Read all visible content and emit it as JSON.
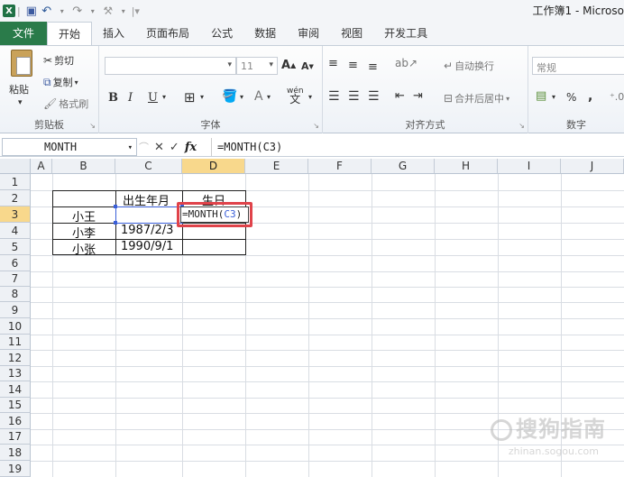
{
  "titlebar": {
    "app_title": "工作簿1 - Microso"
  },
  "tabs": [
    {
      "label": "文件"
    },
    {
      "label": "开始"
    },
    {
      "label": "插入"
    },
    {
      "label": "页面布局"
    },
    {
      "label": "公式"
    },
    {
      "label": "数据"
    },
    {
      "label": "审阅"
    },
    {
      "label": "视图"
    },
    {
      "label": "开发工具"
    }
  ],
  "ribbon": {
    "clipboard": {
      "paste": "粘贴",
      "cut": "剪切",
      "copy": "复制",
      "format_painter": "格式刷",
      "group": "剪贴板"
    },
    "font": {
      "font_name": "",
      "font_size": "11",
      "grow": "A",
      "shrink": "A",
      "bold": "B",
      "italic": "I",
      "underline": "U",
      "phonetic": "wén",
      "group": "字体"
    },
    "alignment": {
      "wrap": "自动换行",
      "merge": "合并后居中",
      "group": "对齐方式"
    },
    "number": {
      "format": "常规",
      "percent": "%",
      "comma": ",",
      "group": "数字"
    }
  },
  "formula_bar": {
    "name_box": "MONTH",
    "cancel": "✕",
    "enter": "✓",
    "fx": "fx",
    "formula": "=MONTH(C3)"
  },
  "columns": [
    "A",
    "B",
    "C",
    "D",
    "E",
    "F",
    "G",
    "H",
    "I",
    "J"
  ],
  "rows": [
    "1",
    "2",
    "3",
    "4",
    "5",
    "6",
    "7",
    "8",
    "9",
    "10",
    "11",
    "12",
    "13",
    "14",
    "15",
    "16",
    "17",
    "18",
    "19"
  ],
  "cells": {
    "C2": "出生年月",
    "D2": "生日",
    "B3": "小王",
    "B4": "小李",
    "C4": "1987/2/3",
    "B5": "小张",
    "C5": "1990/9/1",
    "D3_prefix": "=MONTH(",
    "D3_ref": "C3",
    "D3_suffix": ")"
  },
  "watermark": {
    "text": "搜狗指南",
    "sub": "zhinan.sogou.com"
  }
}
